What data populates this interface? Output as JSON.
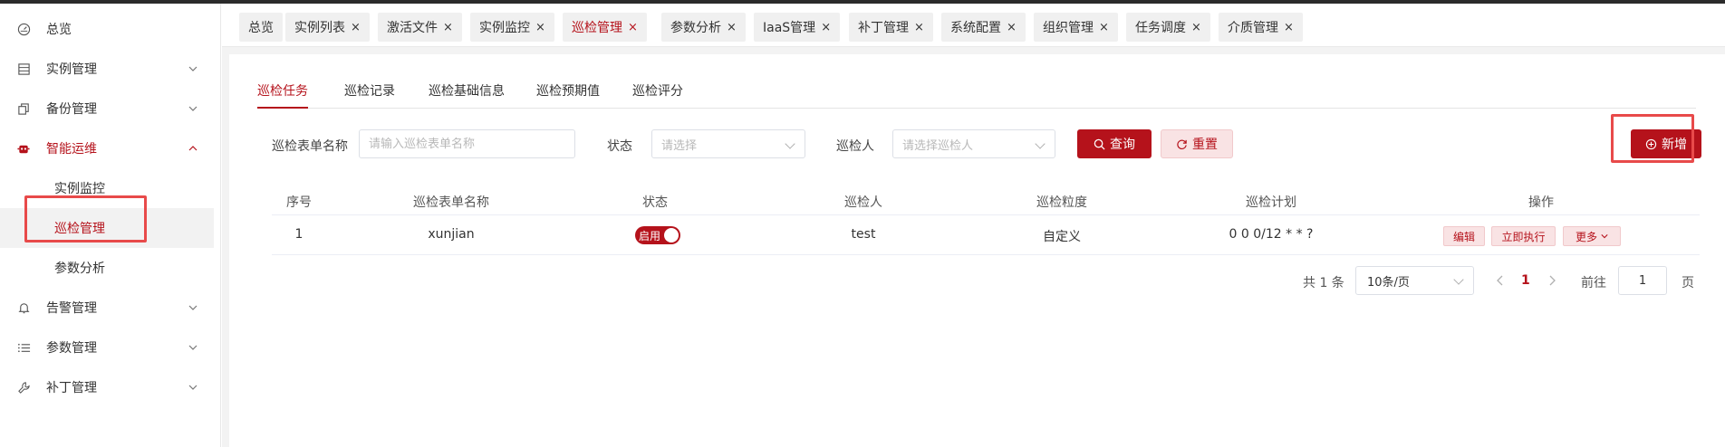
{
  "sidebar": {
    "items": [
      {
        "label": "总览",
        "icon": "dashboard-icon"
      },
      {
        "label": "实例管理",
        "icon": "list-icon"
      },
      {
        "label": "备份管理",
        "icon": "copy-icon"
      },
      {
        "label": "智能运维",
        "icon": "robot-icon"
      },
      {
        "label": "告警管理",
        "icon": "bell-icon"
      },
      {
        "label": "参数管理",
        "icon": "list-lines-icon"
      },
      {
        "label": "补丁管理",
        "icon": "wrench-icon"
      }
    ],
    "submenu": [
      "实例监控",
      "巡检管理",
      "参数分析"
    ]
  },
  "tabs": [
    {
      "label": "总览",
      "closable": false
    },
    {
      "label": "实例列表",
      "closable": true
    },
    {
      "label": "激活文件",
      "closable": true
    },
    {
      "label": "实例监控",
      "closable": true
    },
    {
      "label": "巡检管理",
      "closable": true,
      "active": true
    },
    {
      "label": "参数分析",
      "closable": true
    },
    {
      "label": "IaaS管理",
      "closable": true
    },
    {
      "label": "补丁管理",
      "closable": true
    },
    {
      "label": "系统配置",
      "closable": true
    },
    {
      "label": "组织管理",
      "closable": true
    },
    {
      "label": "任务调度",
      "closable": true
    },
    {
      "label": "介质管理",
      "closable": true
    }
  ],
  "close_glyph": "×",
  "subtabs": [
    "巡检任务",
    "巡检记录",
    "巡检基础信息",
    "巡检预期值",
    "巡检评分"
  ],
  "filters": {
    "name_label": "巡检表单名称",
    "name_placeholder": "请输入巡检表单名称",
    "status_label": "状态",
    "status_placeholder": "请选择",
    "inspector_label": "巡检人",
    "inspector_placeholder": "请选择巡检人",
    "query_label": "查询",
    "reset_label": "重置"
  },
  "add_label": "新增",
  "table": {
    "columns": [
      "序号",
      "巡检表单名称",
      "状态",
      "巡检人",
      "巡检粒度",
      "巡检计划",
      "操作"
    ],
    "rows": [
      {
        "index": "1",
        "name": "xunjian",
        "status": "启用",
        "inspector": "test",
        "granularity": "自定义",
        "plan": "0 0 0/12 * * ?",
        "actions": [
          "编辑",
          "立即执行",
          "更多"
        ]
      }
    ]
  },
  "pagination": {
    "total": "共 1 条",
    "page_size": "10条/页",
    "current_page": "1",
    "goto_label": "前往",
    "goto_value": "1",
    "page_suffix": "页"
  },
  "colors": {
    "accent": "#b5121b",
    "highlight_box": "#e84a4a"
  }
}
